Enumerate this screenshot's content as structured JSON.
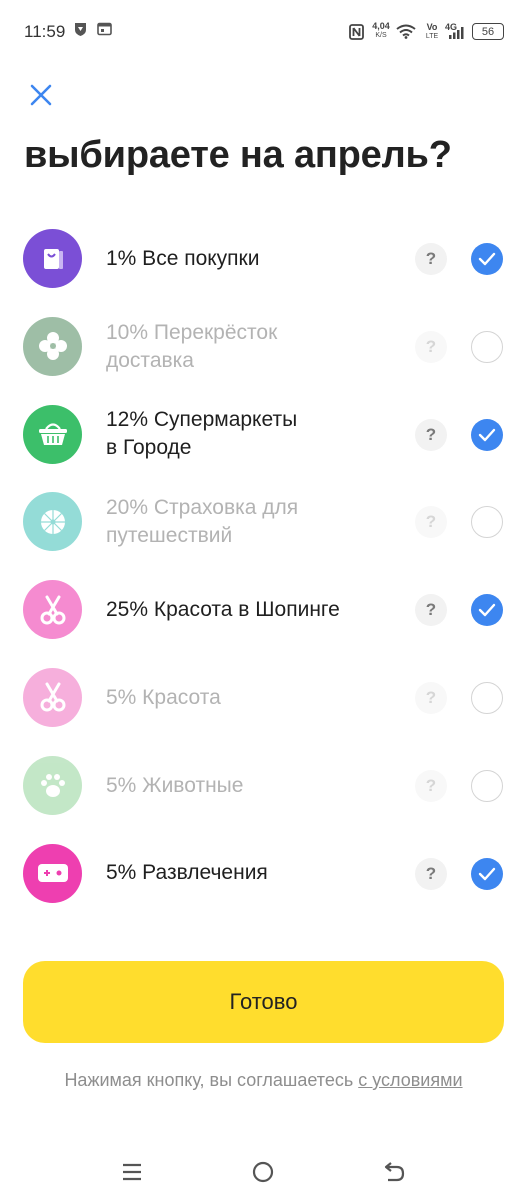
{
  "status_bar": {
    "time": "11:59",
    "speed_value": "4,04",
    "speed_unit": "K/S",
    "volte_top": "Vo",
    "volte_bottom": "LTE",
    "network": "4G",
    "battery": "56"
  },
  "header": {
    "close_icon": "close-icon",
    "title": "выбираете на апрель?"
  },
  "categories": [
    {
      "label": "1% Все покупки",
      "icon": "shopping-bag-icon",
      "color": "#7b4fd6",
      "selected": true,
      "enabled": true
    },
    {
      "label": "10% Перекрёсток\nдоставка",
      "icon": "clover-icon",
      "color": "#4f8a5f",
      "selected": false,
      "enabled": false
    },
    {
      "label": "12% Супермаркеты\nв Городе",
      "icon": "basket-icon",
      "color": "#3cbf6a",
      "selected": true,
      "enabled": true
    },
    {
      "label": "20% Страховка для\nпутешествий",
      "icon": "umbrella-icon",
      "color": "#3ec1b8",
      "selected": false,
      "enabled": false
    },
    {
      "label": "25% Красота в Шопинге",
      "icon": "scissors-icon",
      "color": "#f58bd0",
      "selected": true,
      "enabled": true
    },
    {
      "label": "5% Красота",
      "icon": "scissors-icon",
      "color": "#f06fc1",
      "selected": false,
      "enabled": false
    },
    {
      "label": "5% Животные",
      "icon": "paw-icon",
      "color": "#93d49a",
      "selected": false,
      "enabled": false
    },
    {
      "label": "5% Развлечения",
      "icon": "gamepad-icon",
      "color": "#ee3fb0",
      "selected": true,
      "enabled": true
    }
  ],
  "help_label": "?",
  "done_button": "Готово",
  "terms": {
    "text": "Нажимая кнопку, вы соглашаетесь ",
    "link": "с условиями"
  },
  "colors": {
    "accent_blue": "#3d86f0",
    "button_yellow": "#ffdd2d",
    "text_disabled": "#b3b3b3"
  }
}
